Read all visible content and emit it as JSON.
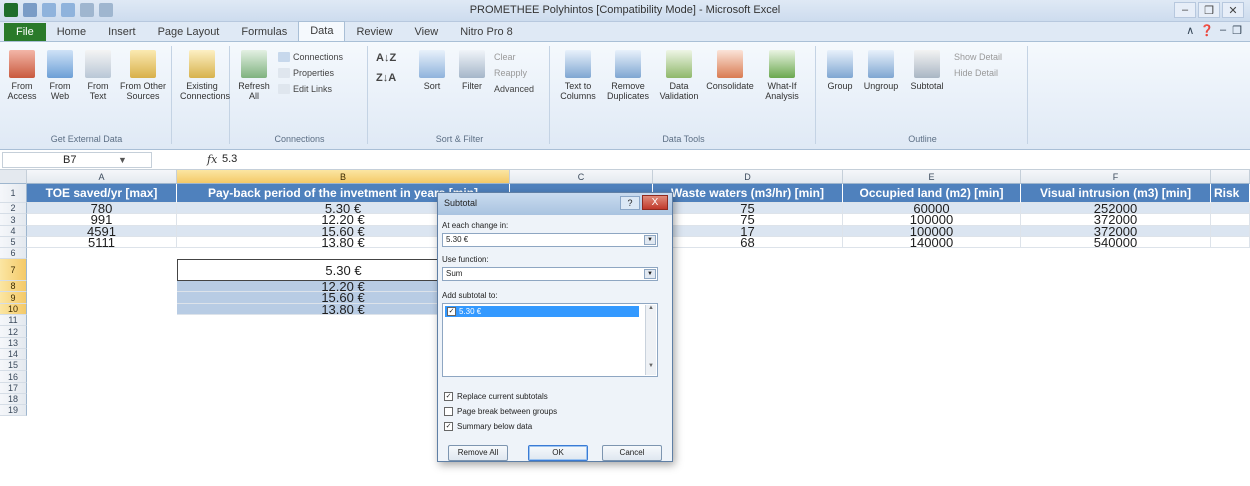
{
  "window": {
    "title": "PROMETHEE Polyhintos [Compatibility Mode] - Microsoft Excel"
  },
  "ribbon_tabs": [
    "File",
    "Home",
    "Insert",
    "Page Layout",
    "Formulas",
    "Data",
    "Review",
    "View",
    "Nitro Pro 8"
  ],
  "active_tab": "Data",
  "ribbon": {
    "get_external": {
      "label": "Get External Data",
      "buttons": [
        "From Access",
        "From Web",
        "From Text",
        "From Other Sources"
      ]
    },
    "existing_connections": "Existing Connections",
    "connections": {
      "label": "Connections",
      "refresh": "Refresh All",
      "small": [
        "Connections",
        "Properties",
        "Edit Links"
      ]
    },
    "sort_filter": {
      "label": "Sort & Filter",
      "sort": "Sort",
      "filter": "Filter",
      "small": [
        "Clear",
        "Reapply",
        "Advanced"
      ]
    },
    "data_tools": {
      "label": "Data Tools",
      "buttons": [
        "Text to Columns",
        "Remove Duplicates",
        "Data Validation",
        "Consolidate",
        "What-If Analysis"
      ]
    },
    "outline": {
      "label": "Outline",
      "buttons": [
        "Group",
        "Ungroup",
        "Subtotal"
      ],
      "small": [
        "Show Detail",
        "Hide Detail"
      ]
    }
  },
  "formula_bar": {
    "name_box": "B7",
    "fx": "fx",
    "value": "5.3"
  },
  "columns": [
    "A",
    "B",
    "C",
    "D",
    "E",
    "F"
  ],
  "selected_column": "B",
  "rows": [
    "1",
    "2",
    "3",
    "4",
    "5",
    "6",
    "7",
    "8",
    "9",
    "10",
    "11",
    "12",
    "13",
    "14",
    "15",
    "16",
    "17",
    "18",
    "19"
  ],
  "headers": [
    "TOE saved/yr [max]",
    "Pay-back period of the invetment in years [min]",
    "",
    "Waste waters (m3/hr) [min]",
    "Occupied land (m2) [min]",
    "Visual intrusion (m3) [min]",
    "Risk"
  ],
  "table_rows": [
    [
      "780",
      "5.30 €",
      "",
      "75",
      "60000",
      "252000"
    ],
    [
      "991",
      "12.20 €",
      "",
      "75",
      "100000",
      "372000"
    ],
    [
      "4591",
      "15.60 €",
      "",
      "17",
      "100000",
      "372000"
    ],
    [
      "5111",
      "13.80 €",
      "",
      "68",
      "140000",
      "540000"
    ]
  ],
  "selection_values": [
    "5.30 €",
    "12.20 €",
    "15.60 €",
    "13.80 €"
  ],
  "dialog": {
    "title": "Subtotal",
    "help": "?",
    "close": "X",
    "each_change_label": "At each change in:",
    "each_change_value": "5.30 €",
    "function_label": "Use function:",
    "function_value": "Sum",
    "add_to_label": "Add subtotal to:",
    "add_to_item": "5.30 €",
    "options": [
      {
        "label": "Replace current subtotals",
        "checked": true
      },
      {
        "label": "Page break between groups",
        "checked": false
      },
      {
        "label": "Summary below data",
        "checked": true
      }
    ],
    "buttons": [
      "Remove All",
      "OK",
      "Cancel"
    ]
  },
  "colors": {
    "header_blue": "#4f81bd",
    "band_light": "#dbe5f1",
    "selection": "#b8cce4",
    "file_tab": "#2a7a2a"
  }
}
